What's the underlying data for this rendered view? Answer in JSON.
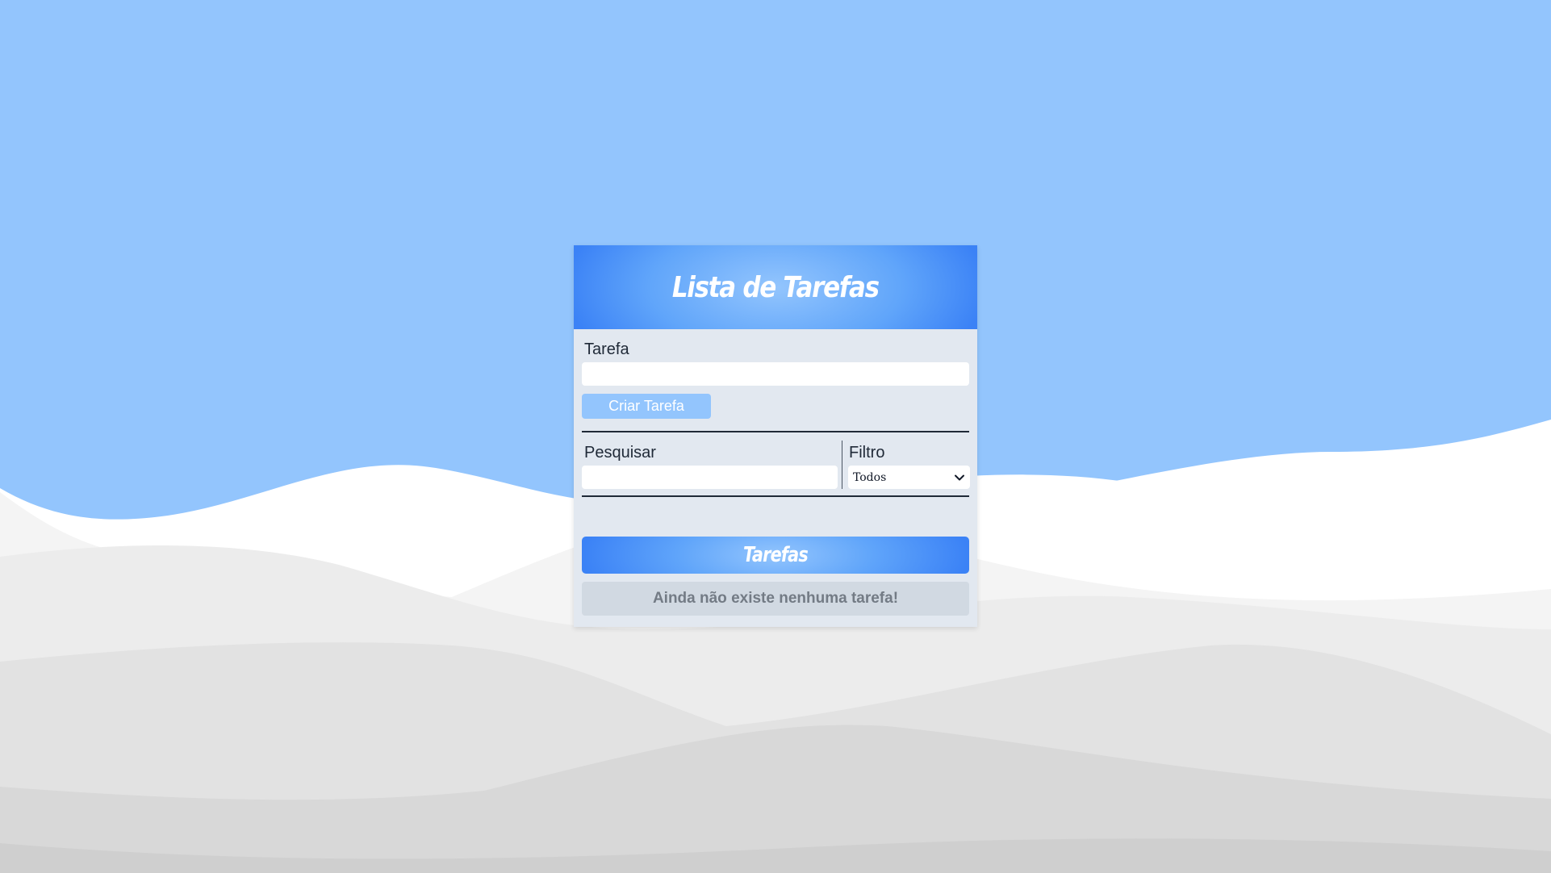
{
  "app": {
    "title": "Lista de Tarefas"
  },
  "form": {
    "task_label": "Tarefa",
    "task_value": "",
    "task_placeholder": "",
    "create_button": "Criar Tarefa"
  },
  "toolbar": {
    "search_label": "Pesquisar",
    "search_value": "",
    "search_placeholder": "",
    "filter_label": "Filtro",
    "filter_selected": "Todos"
  },
  "tasks": {
    "header": "Tarefas",
    "empty_message": "Ainda não existe nenhuma tarefa!",
    "items": []
  },
  "colors": {
    "sky": "#93c5fd",
    "accent": "#3b82f6",
    "card_bg": "#e2e8f0",
    "button_bg": "#93c5fd"
  },
  "icons": {
    "filter_dropdown": "chevron-down-icon"
  }
}
